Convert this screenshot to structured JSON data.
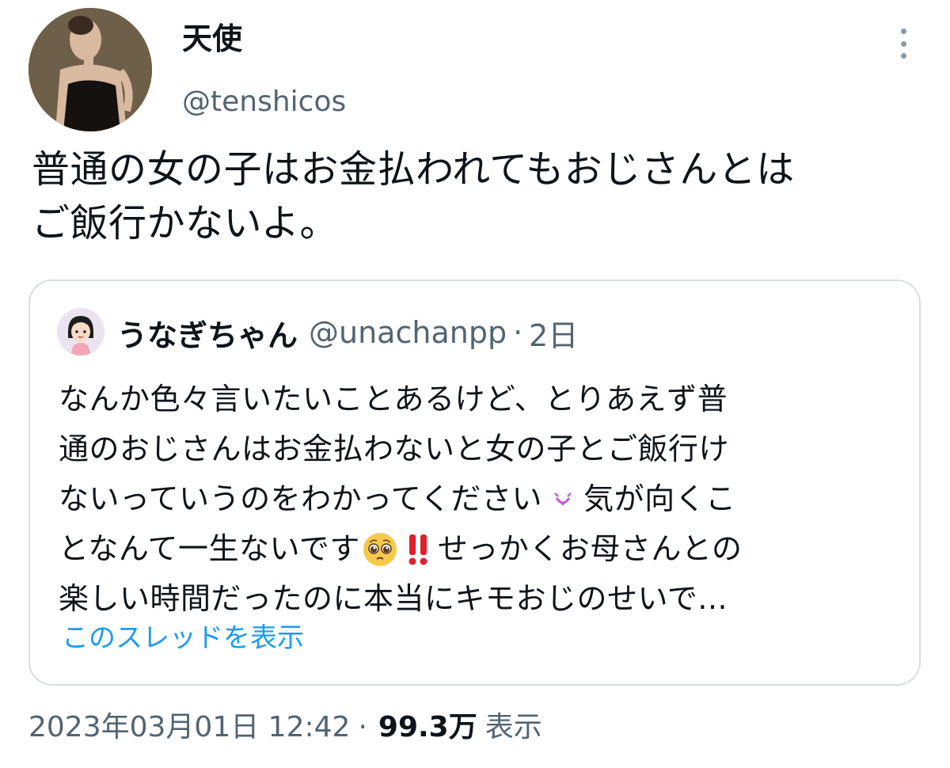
{
  "tweet": {
    "display_name": "天使",
    "handle": "@tenshicos",
    "avatar_icon": "portrait-avatar",
    "more_icon": "more-vertical-icon",
    "text_lines": [
      "普通の女の子はお金払われてもおじさんとは",
      "ご飯行かないよ。"
    ]
  },
  "quote": {
    "display_name": "うなぎちゃん",
    "handle": "@unachanpp",
    "separator": "·",
    "time": "2日",
    "avatar_icon": "cartoon-girl-avatar",
    "lines": [
      {
        "text": "なんか色々言いたいことあるけど、とりあえず普"
      },
      {
        "text": "通のおじさんはお金払わないと女の子とご飯行け"
      },
      {
        "pre": "ないっていうのをわかってください",
        "emoji": "sparkle-heart-icon",
        "post": "気が向くこ"
      },
      {
        "pre": "となんて一生ないです",
        "emoji": "pleading-face-icon",
        "emoji2": "double-exclamation-icon",
        "post": "せっかくお母さんとの"
      },
      {
        "text": "楽しい時間だったのに本当にキモおじのせいで..."
      }
    ],
    "show_thread": "このスレッドを表示"
  },
  "footer": {
    "datetime": "2023年03月01日 12:42",
    "separator": "·",
    "views": "99.3万",
    "views_label": "表示"
  },
  "colors": {
    "text": "#0f1419",
    "secondary": "#536471",
    "link": "#1d9bf0",
    "border": "#d8dde2"
  }
}
